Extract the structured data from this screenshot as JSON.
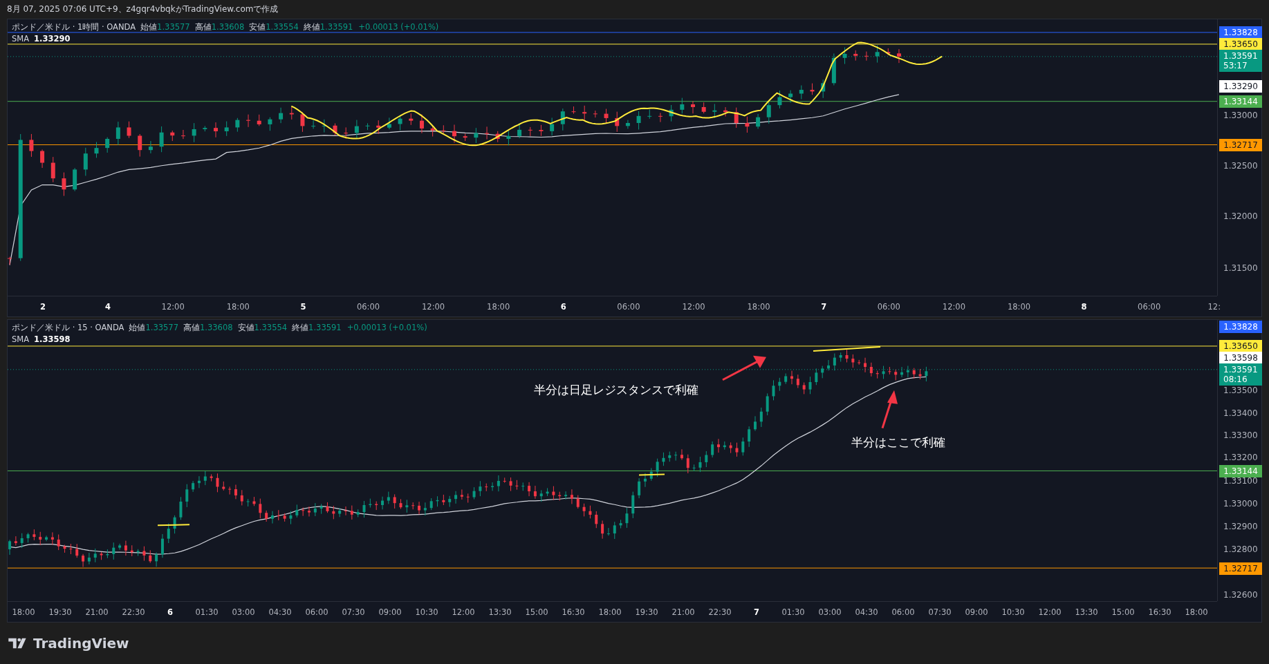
{
  "caption": "8月 07, 2025 07:06 UTC+9、z4gqr4vbqkがTradingView.comで作成",
  "panels": [
    {
      "symbol": "ポンド／米ドル · 1時間 · OANDA",
      "ohlc": [
        {
          "label": "始値",
          "value": "1.33577"
        },
        {
          "label": "高値",
          "value": "1.33608"
        },
        {
          "label": "安値",
          "value": "1.33554"
        },
        {
          "label": "終値",
          "value": "1.33591"
        }
      ],
      "change": "+0.00013 (+0.01%)",
      "indicator": {
        "label": "SMA",
        "value": "1.33290"
      },
      "price_axis": [
        {
          "kind": "badge",
          "text": "1.33828",
          "color": "#2962ff"
        },
        {
          "kind": "badge",
          "text": "1.33650",
          "color": "#ffeb3b"
        },
        {
          "kind": "badge",
          "text": "1.33591",
          "sub": "53:17",
          "color": "#089981"
        },
        {
          "kind": "badge",
          "text": "1.33290",
          "color": "#ffffff"
        },
        {
          "kind": "badge",
          "text": "1.33144",
          "color": "#4caf50"
        },
        {
          "kind": "tick",
          "text": "1.33000"
        },
        {
          "kind": "badge",
          "text": "1.32717",
          "color": "#ff9800"
        },
        {
          "kind": "tick",
          "text": "1.32500"
        },
        {
          "kind": "tick",
          "text": "1.32000"
        },
        {
          "kind": "tick",
          "text": "1.31500"
        }
      ],
      "time_axis": [
        {
          "text": "2",
          "kind": "day"
        },
        {
          "text": "4",
          "kind": "day"
        },
        {
          "text": "12:00",
          "kind": "time"
        },
        {
          "text": "18:00",
          "kind": "time"
        },
        {
          "text": "5",
          "kind": "day"
        },
        {
          "text": "06:00",
          "kind": "time"
        },
        {
          "text": "12:00",
          "kind": "time"
        },
        {
          "text": "18:00",
          "kind": "time"
        },
        {
          "text": "6",
          "kind": "day"
        },
        {
          "text": "06:00",
          "kind": "time"
        },
        {
          "text": "12:00",
          "kind": "time"
        },
        {
          "text": "18:00",
          "kind": "time"
        },
        {
          "text": "7",
          "kind": "day"
        },
        {
          "text": "06:00",
          "kind": "time"
        },
        {
          "text": "12:00",
          "kind": "time"
        },
        {
          "text": "18:00",
          "kind": "time"
        },
        {
          "text": "8",
          "kind": "day"
        },
        {
          "text": "06:00",
          "kind": "time"
        },
        {
          "text": "12:",
          "kind": "time"
        }
      ]
    },
    {
      "symbol": "ポンド／米ドル · 15 · OANDA",
      "ohlc": [
        {
          "label": "始値",
          "value": "1.33577"
        },
        {
          "label": "高値",
          "value": "1.33608"
        },
        {
          "label": "安値",
          "value": "1.33554"
        },
        {
          "label": "終値",
          "value": "1.33591"
        }
      ],
      "change": "+0.00013 (+0.01%)",
      "indicator": {
        "label": "SMA",
        "value": "1.33598"
      },
      "price_axis": [
        {
          "kind": "badge",
          "text": "1.33828",
          "color": "#2962ff"
        },
        {
          "kind": "badge",
          "text": "1.33650",
          "color": "#ffeb3b"
        },
        {
          "kind": "badge",
          "text": "1.33598",
          "color": "#ffffff"
        },
        {
          "kind": "badge",
          "text": "1.33591",
          "sub": "08:16",
          "color": "#089981"
        },
        {
          "kind": "tick",
          "text": "1.33500"
        },
        {
          "kind": "tick",
          "text": "1.33400"
        },
        {
          "kind": "tick",
          "text": "1.33300"
        },
        {
          "kind": "tick",
          "text": "1.33200"
        },
        {
          "kind": "badge",
          "text": "1.33144",
          "color": "#4caf50"
        },
        {
          "kind": "tick",
          "text": "1.33100"
        },
        {
          "kind": "tick",
          "text": "1.33000"
        },
        {
          "kind": "tick",
          "text": "1.32900"
        },
        {
          "kind": "tick",
          "text": "1.32800"
        },
        {
          "kind": "badge",
          "text": "1.32717",
          "color": "#ff9800"
        },
        {
          "kind": "tick",
          "text": "1.32600"
        }
      ],
      "time_axis": [
        {
          "text": "18:00",
          "kind": "time"
        },
        {
          "text": "19:30",
          "kind": "time"
        },
        {
          "text": "21:00",
          "kind": "time"
        },
        {
          "text": "22:30",
          "kind": "time"
        },
        {
          "text": "6",
          "kind": "day"
        },
        {
          "text": "01:30",
          "kind": "time"
        },
        {
          "text": "03:00",
          "kind": "time"
        },
        {
          "text": "04:30",
          "kind": "time"
        },
        {
          "text": "06:00",
          "kind": "time"
        },
        {
          "text": "07:30",
          "kind": "time"
        },
        {
          "text": "09:00",
          "kind": "time"
        },
        {
          "text": "10:30",
          "kind": "time"
        },
        {
          "text": "12:00",
          "kind": "time"
        },
        {
          "text": "13:30",
          "kind": "time"
        },
        {
          "text": "15:00",
          "kind": "time"
        },
        {
          "text": "16:30",
          "kind": "time"
        },
        {
          "text": "18:00",
          "kind": "time"
        },
        {
          "text": "19:30",
          "kind": "time"
        },
        {
          "text": "21:00",
          "kind": "time"
        },
        {
          "text": "22:30",
          "kind": "time"
        },
        {
          "text": "7",
          "kind": "day"
        },
        {
          "text": "01:30",
          "kind": "time"
        },
        {
          "text": "03:00",
          "kind": "time"
        },
        {
          "text": "04:30",
          "kind": "time"
        },
        {
          "text": "06:00",
          "kind": "time"
        },
        {
          "text": "07:30",
          "kind": "time"
        },
        {
          "text": "09:00",
          "kind": "time"
        },
        {
          "text": "10:30",
          "kind": "time"
        },
        {
          "text": "12:00",
          "kind": "time"
        },
        {
          "text": "13:30",
          "kind": "time"
        },
        {
          "text": "15:00",
          "kind": "time"
        },
        {
          "text": "16:30",
          "kind": "time"
        },
        {
          "text": "18:00",
          "kind": "time"
        }
      ],
      "annotations": [
        "半分は日足レジスタンスで利確",
        "半分はここで利確"
      ]
    }
  ],
  "brand": "TradingView"
}
